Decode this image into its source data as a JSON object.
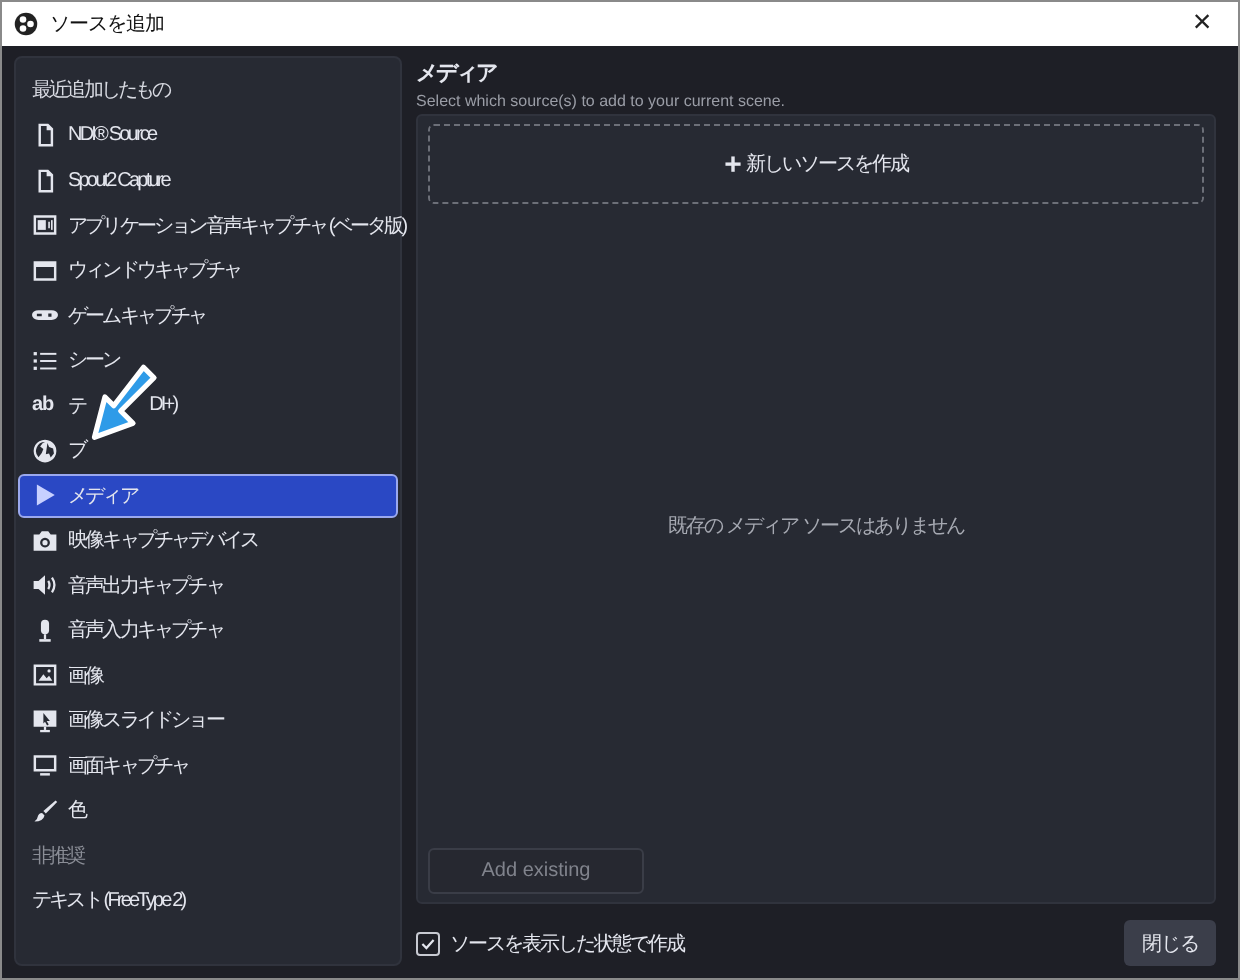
{
  "window": {
    "title": "ソースを追加",
    "close": "×"
  },
  "sidebar": {
    "items": [
      {
        "kind": "heading",
        "label": "最近追加したもの",
        "dimmed": false
      },
      {
        "kind": "source",
        "label": "NDI® Source",
        "selected": false
      },
      {
        "kind": "source",
        "label": "Spout2 Capture",
        "selected": false
      },
      {
        "kind": "source",
        "label": "アプリケーション音声キャプチャ (ベータ版)",
        "selected": false
      },
      {
        "kind": "source",
        "label": "ウィンドウキャプチャ",
        "selected": false
      },
      {
        "kind": "source",
        "label": "ゲームキャプチャ",
        "selected": false
      },
      {
        "kind": "source",
        "label": "シーン",
        "selected": false
      },
      {
        "kind": "source",
        "label_parts": [
          "テ",
          "DI+)"
        ],
        "selected": false,
        "glyph": "ab"
      },
      {
        "kind": "source",
        "label_parts": [
          "ブ"
        ],
        "selected": false
      },
      {
        "kind": "source",
        "label": "メディア",
        "selected": true
      },
      {
        "kind": "source",
        "label": "映像キャプチャデバイス",
        "selected": false
      },
      {
        "kind": "source",
        "label": "音声出力キャプチャ",
        "selected": false
      },
      {
        "kind": "source",
        "label": "音声入力キャプチャ",
        "selected": false
      },
      {
        "kind": "source",
        "label": "画像",
        "selected": false
      },
      {
        "kind": "source",
        "label": "画像スライドショー",
        "selected": false
      },
      {
        "kind": "source",
        "label": "画面キャプチャ",
        "selected": false
      },
      {
        "kind": "source",
        "label": "色",
        "selected": false
      },
      {
        "kind": "heading",
        "label": "非推奨",
        "dimmed": true
      },
      {
        "kind": "plain",
        "label": "テキスト (FreeType 2)",
        "selected": false
      }
    ]
  },
  "main": {
    "title": "メディア",
    "subtitle": "Select which source(s) to add to your current scene.",
    "create_new": {
      "icon": "+",
      "label": "新しいソースを作成"
    },
    "empty_message": "既存の メディア ソースはありません",
    "add_existing": {
      "label": "Add existing",
      "disabled": true
    }
  },
  "footer": {
    "visible_checkbox": {
      "label": "ソースを表示した状態で作成",
      "checked": true
    },
    "close_button": "閉じる"
  }
}
